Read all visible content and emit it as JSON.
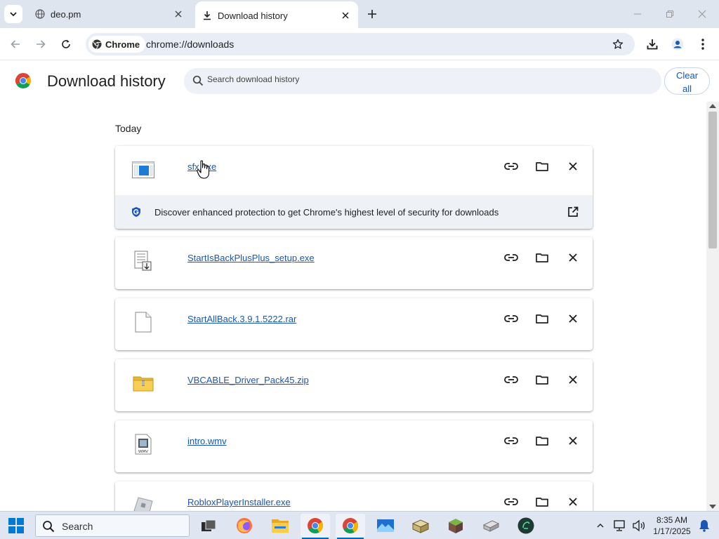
{
  "tabs": [
    {
      "title": "deo.pm",
      "active": false
    },
    {
      "title": "Download history",
      "active": true
    }
  ],
  "toolbar": {
    "chip_label": "Chrome",
    "url": "chrome://downloads"
  },
  "header": {
    "title": "Download history",
    "search_placeholder": "Search download history",
    "clear_all_line1": "Clear",
    "clear_all_line2": "all"
  },
  "downloads": {
    "section": "Today",
    "items": [
      {
        "name": "sfx.exe",
        "icon": "exe-window-icon"
      },
      {
        "name": "StartIsBackPlusPlus_setup.exe",
        "icon": "installer-icon"
      },
      {
        "name": "StartAllBack.3.9.1.5222.rar",
        "icon": "blank-file-icon"
      },
      {
        "name": "VBCABLE_Driver_Pack45.zip",
        "icon": "zip-folder-icon"
      },
      {
        "name": "intro.wmv",
        "icon": "wmv-file-icon"
      },
      {
        "name": "RobloxPlayerInstaller.exe",
        "icon": "roblox-icon"
      }
    ],
    "banner_text": "Discover enhanced protection to get Chrome's highest level of security for downloads"
  },
  "taskbar": {
    "search_label": "Search",
    "time": "8:35 AM",
    "date": "1/17/2025"
  },
  "colors": {
    "accent": "#0b57d0",
    "link": "#1a56b8",
    "tabstrip": "#dfe5ef",
    "taskbar": "#dfe6f1"
  }
}
